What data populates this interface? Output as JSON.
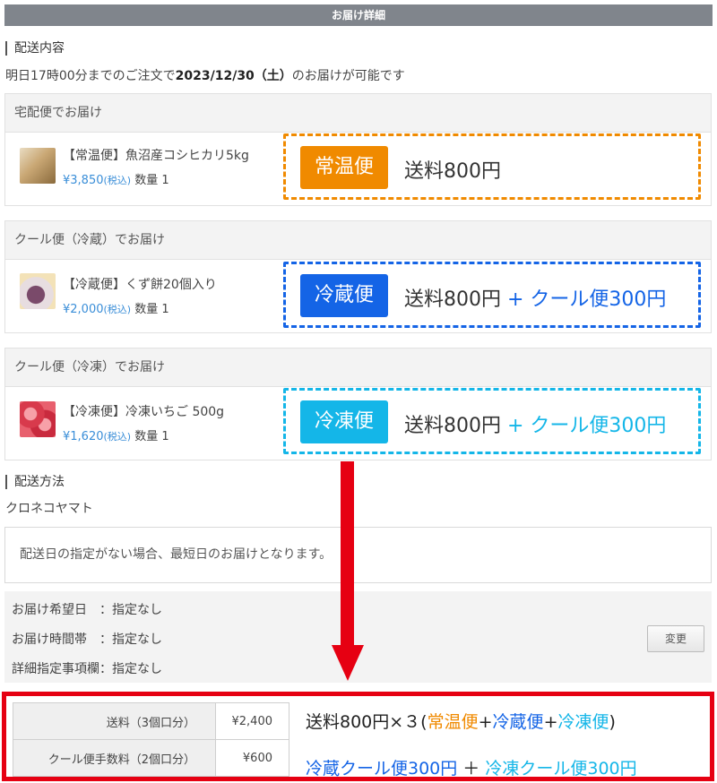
{
  "header": {
    "title": "お届け詳細"
  },
  "delivery_content": {
    "title": "配送内容",
    "notice_pre": "明日17時00分までのご注文で",
    "notice_date": "2023/12/30（土）",
    "notice_post": "のお届けが可能です"
  },
  "groups": [
    {
      "heading": "宅配便でお届け",
      "item": {
        "name": "【常温便】魚沼産コシヒカリ5kg",
        "price": "¥3,850",
        "tax": "(税込)",
        "qty": "数量 1"
      },
      "badge": "常温便",
      "fee": "送料800円",
      "extra": "",
      "accent": "#f08a00"
    },
    {
      "heading": "クール便（冷蔵）でお届け",
      "item": {
        "name": "【冷蔵便】くず餅20個入り",
        "price": "¥2,000",
        "tax": "(税込)",
        "qty": "数量 1"
      },
      "badge": "冷蔵便",
      "fee": "送料800円",
      "extra": " + クール便300円",
      "accent": "#1464e6"
    },
    {
      "heading": "クール便（冷凍）でお届け",
      "item": {
        "name": "【冷凍便】冷凍いちご 500g",
        "price": "¥1,620",
        "tax": "(税込)",
        "qty": "数量 1"
      },
      "badge": "冷凍便",
      "fee": "送料800円",
      "extra": " + クール便300円",
      "accent": "#14b6e8"
    }
  ],
  "delivery_method": {
    "title": "配送方法",
    "carrier": "クロネコヤマト",
    "info": "配送日の指定がない場合、最短日のお届けとなります。",
    "rows": [
      "お届け希望日　：指定なし",
      "お届け時間帯　：指定なし",
      "詳細指定事項欄：指定なし"
    ],
    "change_label": "変更"
  },
  "summary": {
    "rows": [
      {
        "label": "送料（3個口分）",
        "amount": "¥2,400"
      },
      {
        "label": "クール便手数料（2個口分）",
        "amount": "¥600"
      }
    ],
    "line1": {
      "prefix": "送料800円×３(",
      "a": "常温便",
      "plus1": "+",
      "b": "冷蔵便",
      "plus2": "+",
      "c": "冷凍便",
      "suffix": ")"
    },
    "line2": {
      "a": "冷蔵クール便300円",
      "plus": " ＋ ",
      "b": "冷凍クール便300円"
    }
  }
}
